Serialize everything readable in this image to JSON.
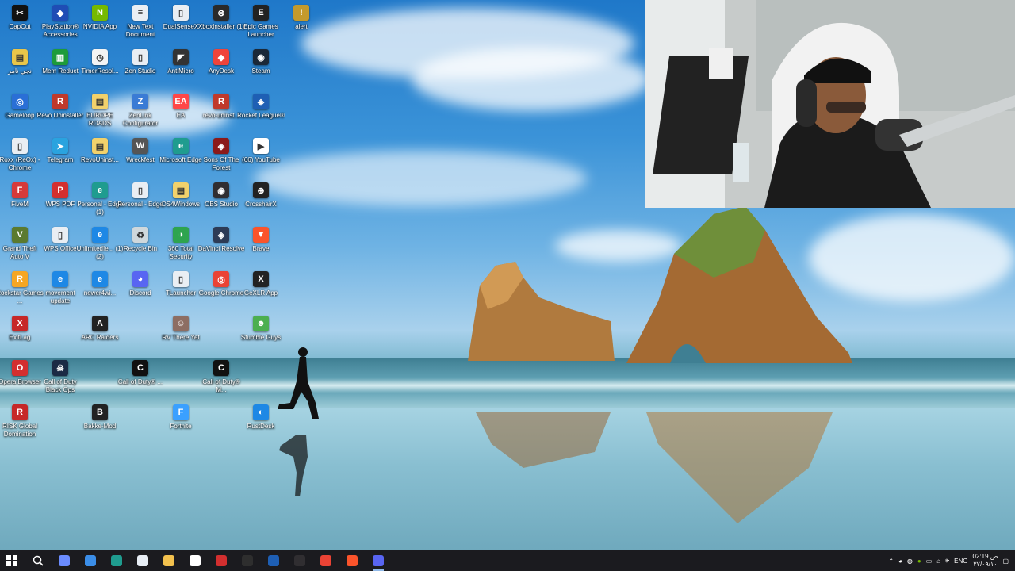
{
  "desktop": {
    "icons": [
      {
        "label": "CapCut",
        "color": "#111111",
        "glyph": "✂"
      },
      {
        "label": "PlayStation® Accessories",
        "color": "#1f4db5",
        "glyph": "◆"
      },
      {
        "label": "NVIDIA App",
        "color": "#76b900",
        "glyph": "N"
      },
      {
        "label": "New Text Document",
        "color": "#e9eef3",
        "glyph": "≡"
      },
      {
        "label": "DualSenseX",
        "color": "#e9eef3",
        "glyph": "▯"
      },
      {
        "label": "XboxInstaller (1)",
        "color": "#2a2a2a",
        "glyph": "⊗"
      },
      {
        "label": "Epic Games Launcher",
        "color": "#222222",
        "glyph": "E"
      },
      {
        "label": "alert",
        "color": "#c49a2c",
        "glyph": "!"
      },
      {
        "label": "نجي نامر",
        "color": "#e8c64a",
        "glyph": "▤"
      },
      {
        "label": "Mem Reduct",
        "color": "#1d9b3a",
        "glyph": "▥"
      },
      {
        "label": "TimerResol...",
        "color": "#f4f4f4",
        "glyph": "◷"
      },
      {
        "label": "Zen Studio",
        "color": "#e9eef3",
        "glyph": "▯"
      },
      {
        "label": "AntiMicro",
        "color": "#333333",
        "glyph": "◤"
      },
      {
        "label": "AnyDesk",
        "color": "#ef443b",
        "glyph": "◆"
      },
      {
        "label": "Steam",
        "color": "#1b2838",
        "glyph": "◉"
      },
      {
        "label": "Gameloop",
        "color": "#2a6fd6",
        "glyph": "◎"
      },
      {
        "label": "Revo Uninstaller",
        "color": "#c0392b",
        "glyph": "R"
      },
      {
        "label": "EUROPE ROADS",
        "color": "#f2d16b",
        "glyph": "▤"
      },
      {
        "label": "ZenLink Configurator",
        "color": "#3a7bd5",
        "glyph": "Z"
      },
      {
        "label": "EA",
        "color": "#ff4747",
        "glyph": "EA"
      },
      {
        "label": "revo-uninst...",
        "color": "#c0392b",
        "glyph": "R"
      },
      {
        "label": "Rocket League®",
        "color": "#1e5fb4",
        "glyph": "◈"
      },
      {
        "label": "Roxx (ReOx) - Chrome",
        "color": "#e9eef3",
        "glyph": "▯"
      },
      {
        "label": "Telegram",
        "color": "#2aa3df",
        "glyph": "➤"
      },
      {
        "label": "RevoUninst...",
        "color": "#f2d16b",
        "glyph": "▤"
      },
      {
        "label": "Wreckfest",
        "color": "#555555",
        "glyph": "W"
      },
      {
        "label": "Microsoft Edge",
        "color": "#1f9c8f",
        "glyph": "e"
      },
      {
        "label": "Sons Of The Forest",
        "color": "#8b1a1a",
        "glyph": "◈"
      },
      {
        "label": "(66) YouTube",
        "color": "#ffffff",
        "glyph": "▶"
      },
      {
        "label": "FiveM",
        "color": "#d63a3a",
        "glyph": "F"
      },
      {
        "label": "WPS PDF",
        "color": "#d32f2f",
        "glyph": "P"
      },
      {
        "label": "Personal - Edge (1)",
        "color": "#1f9c8f",
        "glyph": "e"
      },
      {
        "label": "Personal - Edge",
        "color": "#e9eef3",
        "glyph": "▯"
      },
      {
        "label": "DS4Windows",
        "color": "#f2d16b",
        "glyph": "▤"
      },
      {
        "label": "OBS Studio",
        "color": "#302e31",
        "glyph": "◉"
      },
      {
        "label": "CrosshairX",
        "color": "#222222",
        "glyph": "⊕"
      },
      {
        "label": "Grand Theft Auto V",
        "color": "#5b7a2f",
        "glyph": "V"
      },
      {
        "label": "WPS Office",
        "color": "#e9eef3",
        "glyph": "▯"
      },
      {
        "label": "UnlimitedIe... (1) (2)",
        "color": "#1e88e5",
        "glyph": "e"
      },
      {
        "label": "Recycle Bin",
        "color": "#cfd8dc",
        "glyph": "♻"
      },
      {
        "label": "360 Total Security",
        "color": "#2ea44f",
        "glyph": "◑"
      },
      {
        "label": "DaVinci Resolve",
        "color": "#2d3b55",
        "glyph": "◈"
      },
      {
        "label": "Brave",
        "color": "#fb542b",
        "glyph": "▼"
      },
      {
        "label": "Rockstar Games ...",
        "color": "#f5a623",
        "glyph": "R"
      },
      {
        "label": "movement update",
        "color": "#1e88e5",
        "glyph": "e"
      },
      {
        "label": "newer4wi...",
        "color": "#1e88e5",
        "glyph": "e"
      },
      {
        "label": "Discord",
        "color": "#5865f2",
        "glyph": "◕"
      },
      {
        "label": "TLauncher",
        "color": "#e9eef3",
        "glyph": "▯"
      },
      {
        "label": "Google Chrome",
        "color": "#ea4335",
        "glyph": "◎"
      },
      {
        "label": "GeXLR App",
        "color": "#222222",
        "glyph": "X"
      },
      {
        "label": "ExitLag",
        "color": "#c62828",
        "glyph": "X"
      },
      {
        "label": "ARC Raiders",
        "color": "#222222",
        "glyph": "A"
      },
      {
        "label": "RV There Yet",
        "color": "#8d6e63",
        "glyph": "☺"
      },
      {
        "label": "Stumble Guys",
        "color": "#4caf50",
        "glyph": "☻"
      },
      {
        "label": "Opera Browser",
        "color": "#d32f2f",
        "glyph": "O"
      },
      {
        "label": "Call of Duty Black Ops",
        "color": "#1b2a45",
        "glyph": "☠"
      },
      {
        "label": "Call of Duty® ...",
        "color": "#111111",
        "glyph": "C"
      },
      {
        "label": "Call of Duty® M...",
        "color": "#111111",
        "glyph": "C"
      },
      {
        "label": "RISK Global Domination",
        "color": "#c62828",
        "glyph": "R"
      },
      {
        "label": "Bakke-Mod",
        "color": "#222222",
        "glyph": "B"
      },
      {
        "label": "Fortnite",
        "color": "#3aa0ff",
        "glyph": "F"
      },
      {
        "label": "RustDesk",
        "color": "#1e88e5",
        "glyph": "◐"
      }
    ]
  },
  "webcam": {
    "description_label": ""
  },
  "taskbar": {
    "apps": [
      {
        "name": "start-button",
        "color": "#ffffff",
        "active": false
      },
      {
        "name": "search-button",
        "color": "#ffffff",
        "active": false
      },
      {
        "name": "copilot-button",
        "color": "#6b8cff",
        "active": false
      },
      {
        "name": "mail-button",
        "color": "#3b8ee8",
        "active": false
      },
      {
        "name": "edge-button",
        "color": "#1f9c8f",
        "active": false
      },
      {
        "name": "store-button",
        "color": "#e8eef5",
        "active": false
      },
      {
        "name": "file-explorer-button",
        "color": "#f2c14e",
        "active": false
      },
      {
        "name": "capcut-button",
        "color": "#ffffff",
        "active": false
      },
      {
        "name": "opera-button",
        "color": "#d32f2f",
        "active": false
      },
      {
        "name": "gexlr-button",
        "color": "#2e2e2e",
        "active": false
      },
      {
        "name": "rocket-league-button",
        "color": "#1e5fb4",
        "active": false
      },
      {
        "name": "obs-button",
        "color": "#302e31",
        "active": false
      },
      {
        "name": "chrome-button",
        "color": "#ea4335",
        "active": false
      },
      {
        "name": "brave-button",
        "color": "#fb542b",
        "active": false
      },
      {
        "name": "discord-button",
        "color": "#5865f2",
        "active": true
      }
    ],
    "tray": {
      "language": "ENG",
      "time": "02:19 ص",
      "date": "٢٧/٠٩/١٠"
    }
  }
}
